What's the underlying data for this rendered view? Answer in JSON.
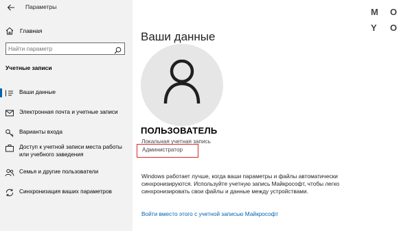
{
  "app": {
    "title": "Параметры"
  },
  "sidebar": {
    "home_label": "Главная",
    "search_placeholder": "Найти параметр",
    "section_heading": "Учетные записи",
    "items": [
      {
        "label": "Ваши данные",
        "icon": "person-card-icon"
      },
      {
        "label": "Электронная почта и учетные записи",
        "icon": "mail-icon"
      },
      {
        "label": "Варианты входа",
        "icon": "key-icon"
      },
      {
        "label": "Доступ к учетной записи места работы или учебного заведения",
        "icon": "briefcase-icon"
      },
      {
        "label": "Семья и другие пользователи",
        "icon": "people-icon"
      },
      {
        "label": "Синхронизация ваших параметров",
        "icon": "sync-icon"
      }
    ]
  },
  "main": {
    "title": "Ваши данные",
    "user_name": "ПОЛЬЗОВАТЕЛЬ",
    "account_type": "Локальная учетная запись",
    "role": "Администратор",
    "sync_text": "Windows работает лучше, когда ваши параметры и файлы автоматически синхронизируются. Используйте учетную запись Майкрософт, чтобы легко синхронизировать свои файлы и данные между устройствами.",
    "ms_link": "Войти вместо этого с учетной записью Майкрософт"
  },
  "logo": {
    "letters": [
      "M",
      "O",
      "Y",
      "O"
    ]
  },
  "colors": {
    "accent": "#0063b1",
    "highlight_box": "#d9252a",
    "sidebar_bg": "#f2f2f2",
    "avatar_bg": "#e6e6e6"
  }
}
